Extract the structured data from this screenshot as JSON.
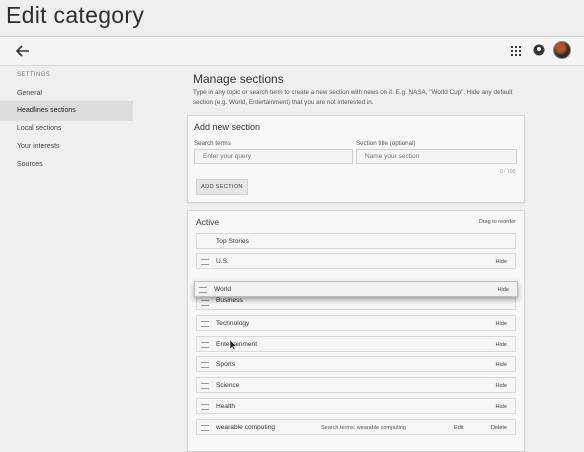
{
  "page": {
    "title": "Edit category"
  },
  "topbar": {
    "icons": [
      "back-arrow-icon",
      "apps-grid-icon",
      "account-circle-icon",
      "avatar"
    ]
  },
  "sidebar": {
    "heading": "SETTINGS",
    "items": [
      {
        "label": "General",
        "active": false
      },
      {
        "label": "Headlines sections",
        "active": true
      },
      {
        "label": "Local sections",
        "active": false
      },
      {
        "label": "Your interests",
        "active": false
      },
      {
        "label": "Sources",
        "active": false
      }
    ]
  },
  "manage": {
    "title": "Manage sections",
    "description": "Type in any topic or search term to create a new section with news on it. E.g. NASA, \"World Cup\". Hide any default section (e.g. World, Entertainment) that you are not interested in."
  },
  "add_section": {
    "title": "Add new section",
    "search_label": "Search terms",
    "search_placeholder": "Enter your query",
    "section_title_label": "Section title (optional)",
    "section_title_placeholder": "Name your section",
    "counter": "0 / 100",
    "button_label": "ADD SECTION"
  },
  "active": {
    "title": "Active",
    "hint": "Drag to reorder",
    "rows": [
      {
        "name": "Top Stories"
      },
      {
        "name": "U.S.",
        "action": "Hide"
      },
      {
        "name": "World",
        "action": "Hide"
      },
      {
        "name": "Business"
      },
      {
        "name": "Technology",
        "action": "Hide"
      },
      {
        "name": "Entertainment",
        "action": "Hide"
      },
      {
        "name": "Sports",
        "action": "Hide"
      },
      {
        "name": "Science",
        "action": "Hide"
      },
      {
        "name": "Health",
        "action": "Hide"
      },
      {
        "name": "wearable computing",
        "meta": "Search terms: wearable computing",
        "edit": "Edit",
        "delete": "Delete"
      }
    ]
  }
}
